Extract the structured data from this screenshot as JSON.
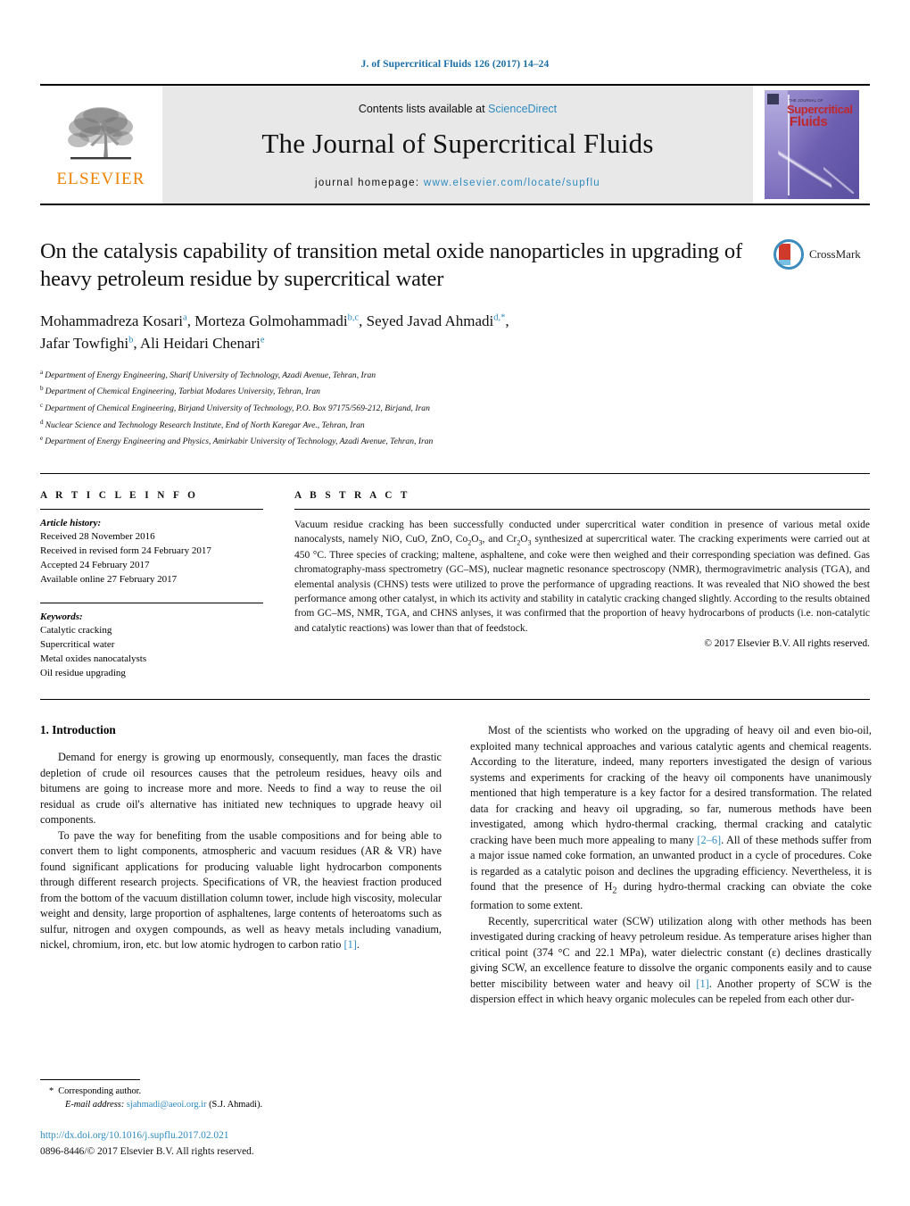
{
  "running_head": "J. of Supercritical Fluids 126 (2017) 14–24",
  "masthead": {
    "publisher_name": "ELSEVIER",
    "contents_prefix": "Contents lists available at ",
    "contents_link": "ScienceDirect",
    "journal_title": "The Journal of Supercritical Fluids",
    "homepage_prefix": "journal homepage: ",
    "homepage_url": "www.elsevier.com/locate/supflu",
    "cover": {
      "kicker": "THE JOURNAL OF",
      "line1": "Supercritical",
      "line2": "Fluids"
    }
  },
  "article": {
    "title": "On the catalysis capability of transition metal oxide nanoparticles in upgrading of heavy petroleum residue by supercritical water",
    "crossmark_label": "CrossMark",
    "authors_line1": "Mohammadreza Kosari",
    "authors_line1_sup": "a",
    "authors_line2": "Morteza Golmohammadi",
    "authors_line2_sup": "b,c",
    "authors_line3": "Seyed Javad Ahmadi",
    "authors_line3_sup": "d,*",
    "authors_line4": "Jafar Towfighi",
    "authors_line4_sup": "b",
    "authors_line5": "Ali Heidari Chenari",
    "authors_line5_sup": "e",
    "affiliations": [
      {
        "mark": "a",
        "text": "Department of Energy Engineering, Sharif University of Technology, Azadi Avenue, Tehran, Iran"
      },
      {
        "mark": "b",
        "text": "Department of Chemical Engineering, Tarbiat Modares University, Tehran, Iran"
      },
      {
        "mark": "c",
        "text": "Department of Chemical Engineering, Birjand University of Technology, P.O. Box 97175/569-212, Birjand, Iran"
      },
      {
        "mark": "d",
        "text": "Nuclear Science and Technology Research Institute, End of North Karegar Ave., Tehran, Iran"
      },
      {
        "mark": "e",
        "text": "Department of Energy Engineering and Physics, Amirkabir University of Technology, Azadi Avenue, Tehran, Iran"
      }
    ]
  },
  "article_info": {
    "label": "A R T I C L E    I N F O",
    "history_head": "Article history:",
    "history": [
      "Received 28 November 2016",
      "Received in revised form 24 February 2017",
      "Accepted 24 February 2017",
      "Available online 27 February 2017"
    ],
    "keywords_head": "Keywords:",
    "keywords": [
      "Catalytic cracking",
      "Supercritical water",
      "Metal oxides nanocatalysts",
      "Oil residue upgrading"
    ]
  },
  "abstract": {
    "label": "A B S T R A C T",
    "paragraph_part1": "Vacuum residue cracking has been successfully conducted under supercritical water condition in presence of various metal oxide nanocalysts, namely NiO, CuO, ZnO, Co",
    "sub1": "2",
    "paragraph_part2": "O",
    "sub2": "3",
    "paragraph_part3": ", and Cr",
    "sub3": "2",
    "paragraph_part4": "O",
    "sub4": "3",
    "paragraph_part5": " synthesized at supercritical water. The cracking experiments were carried out at 450 °C. Three species of cracking; maltene, asphaltene, and coke were then weighed and their corresponding speciation was defined. Gas chromatography-mass spectrometry (GC–MS), nuclear magnetic resonance spectroscopy (NMR), thermogravimetric analysis (TGA), and elemental analysis (CHNS) tests were utilized to prove the performance of upgrading reactions. It was revealed that NiO showed the best performance among other catalyst, in which its activity and stability in catalytic cracking changed slightly. According to the results obtained from GC–MS, NMR, TGA, and CHNS anlyses, it was confirmed that the proportion of heavy hydrocarbons of products (i.e. non-catalytic and catalytic reactions) was lower than that of feedstock.",
    "copyright": "© 2017 Elsevier B.V. All rights reserved."
  },
  "body": {
    "section_number_title": "1.  Introduction",
    "left_paragraphs": [
      "Demand for energy is growing up enormously, consequently, man faces the drastic depletion of crude oil resources causes that the petroleum residues, heavy oils and bitumens are going to increase more and more. Needs to find a way to reuse the oil residual as crude oil's alternative has initiated new techniques to upgrade heavy oil components."
    ],
    "left_paragraph2_pre": "To pave the way for benefiting from the usable compositions and for being able to convert them to light components, atmospheric and vacuum residues (AR & VR) have found significant applications for producing valuable light hydrocarbon components through different research projects. Specifications of VR, the heaviest fraction produced from the bottom of the vacuum distillation column tower, include high viscosity, molecular weight and density, large proportion of asphaltenes, large contents of heteroatoms such as sulfur, nitrogen and oxygen compounds, as well as heavy metals including vanadium, nickel, chromium, iron, etc. but low atomic hydrogen to carbon ratio ",
    "left_paragraph2_ref": "[1]",
    "left_paragraph2_post": ".",
    "right_paragraph1_pre": "Most of the scientists who worked on the upgrading of heavy oil and even bio-oil, exploited many technical approaches and various catalytic agents and chemical reagents. According to the literature, indeed, many reporters investigated the design of various systems and experiments for cracking of the heavy oil components have unanimously mentioned that high temperature is a key factor for a desired transformation. The related data for cracking and heavy oil upgrading, so far, numerous methods have been investigated, among which hydro-thermal cracking, thermal cracking and catalytic cracking have been much more appealing to many ",
    "right_paragraph1_ref": "[2–6]",
    "right_paragraph1_post": ". All of these methods suffer from a major issue named coke formation, an unwanted product in a cycle of procedures. Coke is regarded as a catalytic poison and declines the upgrading efficiency. Nevertheless, it is found that the presence of H",
    "right_paragraph1_sub": "2",
    "right_paragraph1_tail": " during hydro-thermal cracking can obviate the coke formation to some extent.",
    "right_paragraph2_pre": "Recently, supercritical water (SCW) utilization along with other methods has been investigated during cracking of heavy petroleum residue. As temperature arises higher than critical point (374 °C and 22.1 MPa), water dielectric constant (ε) declines drastically giving SCW, an excellence feature to dissolve the organic components easily and to cause better miscibility between water and heavy oil ",
    "right_paragraph2_ref": "[1]",
    "right_paragraph2_post": ". Another property of SCW is the dispersion effect in which heavy organic molecules can be repeled from each other dur-"
  },
  "footnotes": {
    "corresponding_star": "*",
    "corresponding_label": "Corresponding author.",
    "email_label": "E-mail address:",
    "email": "sjahmadi@aeoi.org.ir",
    "email_owner": "(S.J. Ahmadi).",
    "doi_url": "http://dx.doi.org/10.1016/j.supflu.2017.02.021",
    "issn_line": "0896-8446/© 2017 Elsevier B.V. All rights reserved."
  },
  "colors": {
    "link_blue": "#2e8bc0",
    "running_head_blue": "#1a6fa8",
    "elsevier_orange": "#ef8200",
    "masthead_gray": "#e8e8e8",
    "crossmark_red": "#cf3a2a",
    "crossmark_blue": "#3b8bbd"
  }
}
